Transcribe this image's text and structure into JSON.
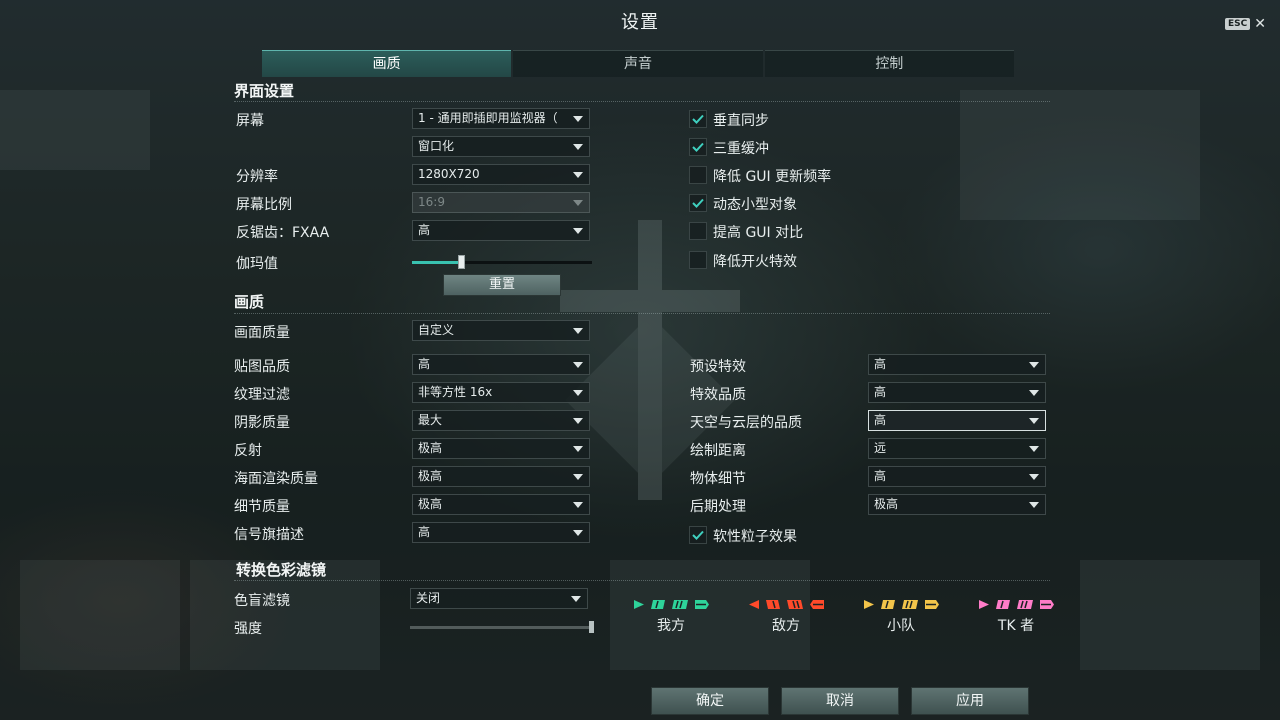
{
  "window": {
    "title": "设置",
    "esc_label": "ESC"
  },
  "tabs": [
    {
      "label": "画质",
      "active": true
    },
    {
      "label": "声音",
      "active": false
    },
    {
      "label": "控制",
      "active": false
    }
  ],
  "interface": {
    "heading": "界面设置",
    "screen": {
      "label": "屏幕",
      "value": "1 - 通用即插即用监视器（"
    },
    "window_mode": {
      "value": "窗口化"
    },
    "resolution": {
      "label": "分辨率",
      "value": "1280X720"
    },
    "aspect": {
      "label": "屏幕比例",
      "value": "16:9"
    },
    "antialias": {
      "label": "反锯齿：FXAA",
      "value": "高"
    },
    "gamma": {
      "label": "伽玛值",
      "level": 0.27
    },
    "reset_label": "重置",
    "checkboxes": [
      {
        "label": "垂直同步",
        "checked": true
      },
      {
        "label": "三重缓冲",
        "checked": true
      },
      {
        "label": "降低 GUI 更新频率",
        "checked": false
      },
      {
        "label": "动态小型对象",
        "checked": true
      },
      {
        "label": "提高 GUI 对比",
        "checked": false
      },
      {
        "label": "降低开火特效",
        "checked": false
      }
    ]
  },
  "quality": {
    "heading": "画质",
    "preset": {
      "label": "画面质量",
      "value": "自定义"
    },
    "left": [
      {
        "label": "贴图品质",
        "value": "高"
      },
      {
        "label": "纹理过滤",
        "value": "非等方性 16x"
      },
      {
        "label": "阴影质量",
        "value": "最大"
      },
      {
        "label": "反射",
        "value": "极高"
      },
      {
        "label": "海面渲染质量",
        "value": "极高"
      },
      {
        "label": "细节质量",
        "value": "极高"
      },
      {
        "label": "信号旗描述",
        "value": "高"
      }
    ],
    "right": [
      {
        "label": "预设特效",
        "value": "高"
      },
      {
        "label": "特效品质",
        "value": "高"
      },
      {
        "label": "天空与云层的品质",
        "value": "高"
      },
      {
        "label": "绘制距离",
        "value": "远"
      },
      {
        "label": "物体细节",
        "value": "高"
      },
      {
        "label": "后期处理",
        "value": "极高"
      }
    ],
    "soft_particles": {
      "label": "软性粒子效果",
      "checked": true
    }
  },
  "colorblind": {
    "heading": "转换色彩滤镜",
    "filter": {
      "label": "色盲滤镜",
      "value": "关闭"
    },
    "intensity": {
      "label": "强度",
      "level": 1.0
    },
    "groups": [
      {
        "name": "我方",
        "color": "#2ed39a"
      },
      {
        "name": "敌方",
        "color": "#ff4a2a"
      },
      {
        "name": "小队",
        "color": "#f2c44a"
      },
      {
        "name": "TK 者",
        "color": "#ff7cc8"
      }
    ]
  },
  "footer": {
    "ok_label": "确定",
    "cancel_label": "取消",
    "apply_label": "应用"
  }
}
